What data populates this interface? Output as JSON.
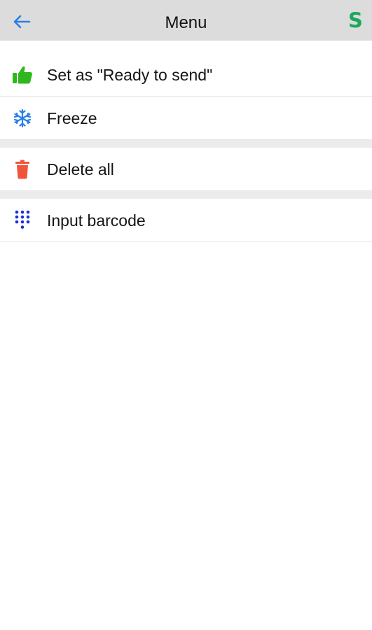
{
  "header": {
    "title": "Menu",
    "brand_letter": "S",
    "back_icon": "arrow-left-icon"
  },
  "menu": {
    "items": [
      {
        "label": "Set as \"Ready to send\"",
        "icon": "thumbs-up-icon",
        "color": "#2fb81e"
      },
      {
        "label": "Freeze",
        "icon": "snowflake-icon",
        "color": "#2a7fe6"
      },
      {
        "label": "Delete all",
        "icon": "trash-icon",
        "color": "#f0543a"
      },
      {
        "label": "Input barcode",
        "icon": "dialpad-icon",
        "color": "#1c2fd6"
      }
    ]
  },
  "colors": {
    "header_bg": "#dcdcdc",
    "back_arrow": "#2a7fe6",
    "brand": "#1aa85a",
    "divider": "#ececec"
  }
}
